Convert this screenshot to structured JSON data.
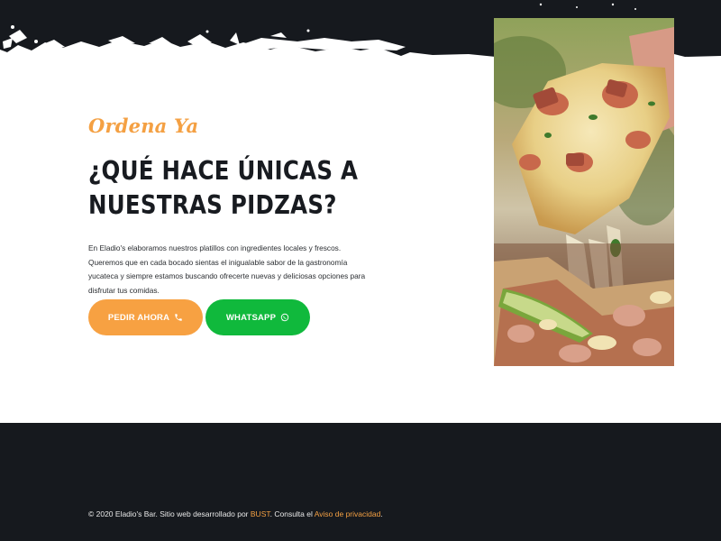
{
  "hero": {
    "tagline": "Ordena Ya",
    "headline_line1": "¿QUÉ HACE ÚNICAS A",
    "headline_line2": "NUESTRAS PIDZAS?",
    "description": "En Eladio's elaboramos nuestros platillos con ingredientes locales y frescos. Queremos que en cada bocado sientas el inigualable sabor de la gastronomía yucateca y siempre estamos buscando ofrecerte nuevas y deliciosas opciones para disfrutar tus comidas.",
    "buttons": {
      "order_label": "PEDIR AHORA",
      "order_icon": "phone-icon",
      "whatsapp_label": "WHATSAPP",
      "whatsapp_icon": "whatsapp-icon"
    },
    "image": "pizza-slice-cheese-pull-photo"
  },
  "footer": {
    "copyright_prefix": "© 2020 Eladio's Bar. Sitio web desarrollado por ",
    "dev_link": "BUST",
    "middle": ". Consulta el ",
    "privacy_link": "Aviso de privacidad",
    "suffix": "."
  },
  "colors": {
    "accent_orange": "#f4a043",
    "button_orange": "#f7a142",
    "whatsapp_green": "#10b93c",
    "dark": "#16191e",
    "text_dark": "#181b20"
  }
}
